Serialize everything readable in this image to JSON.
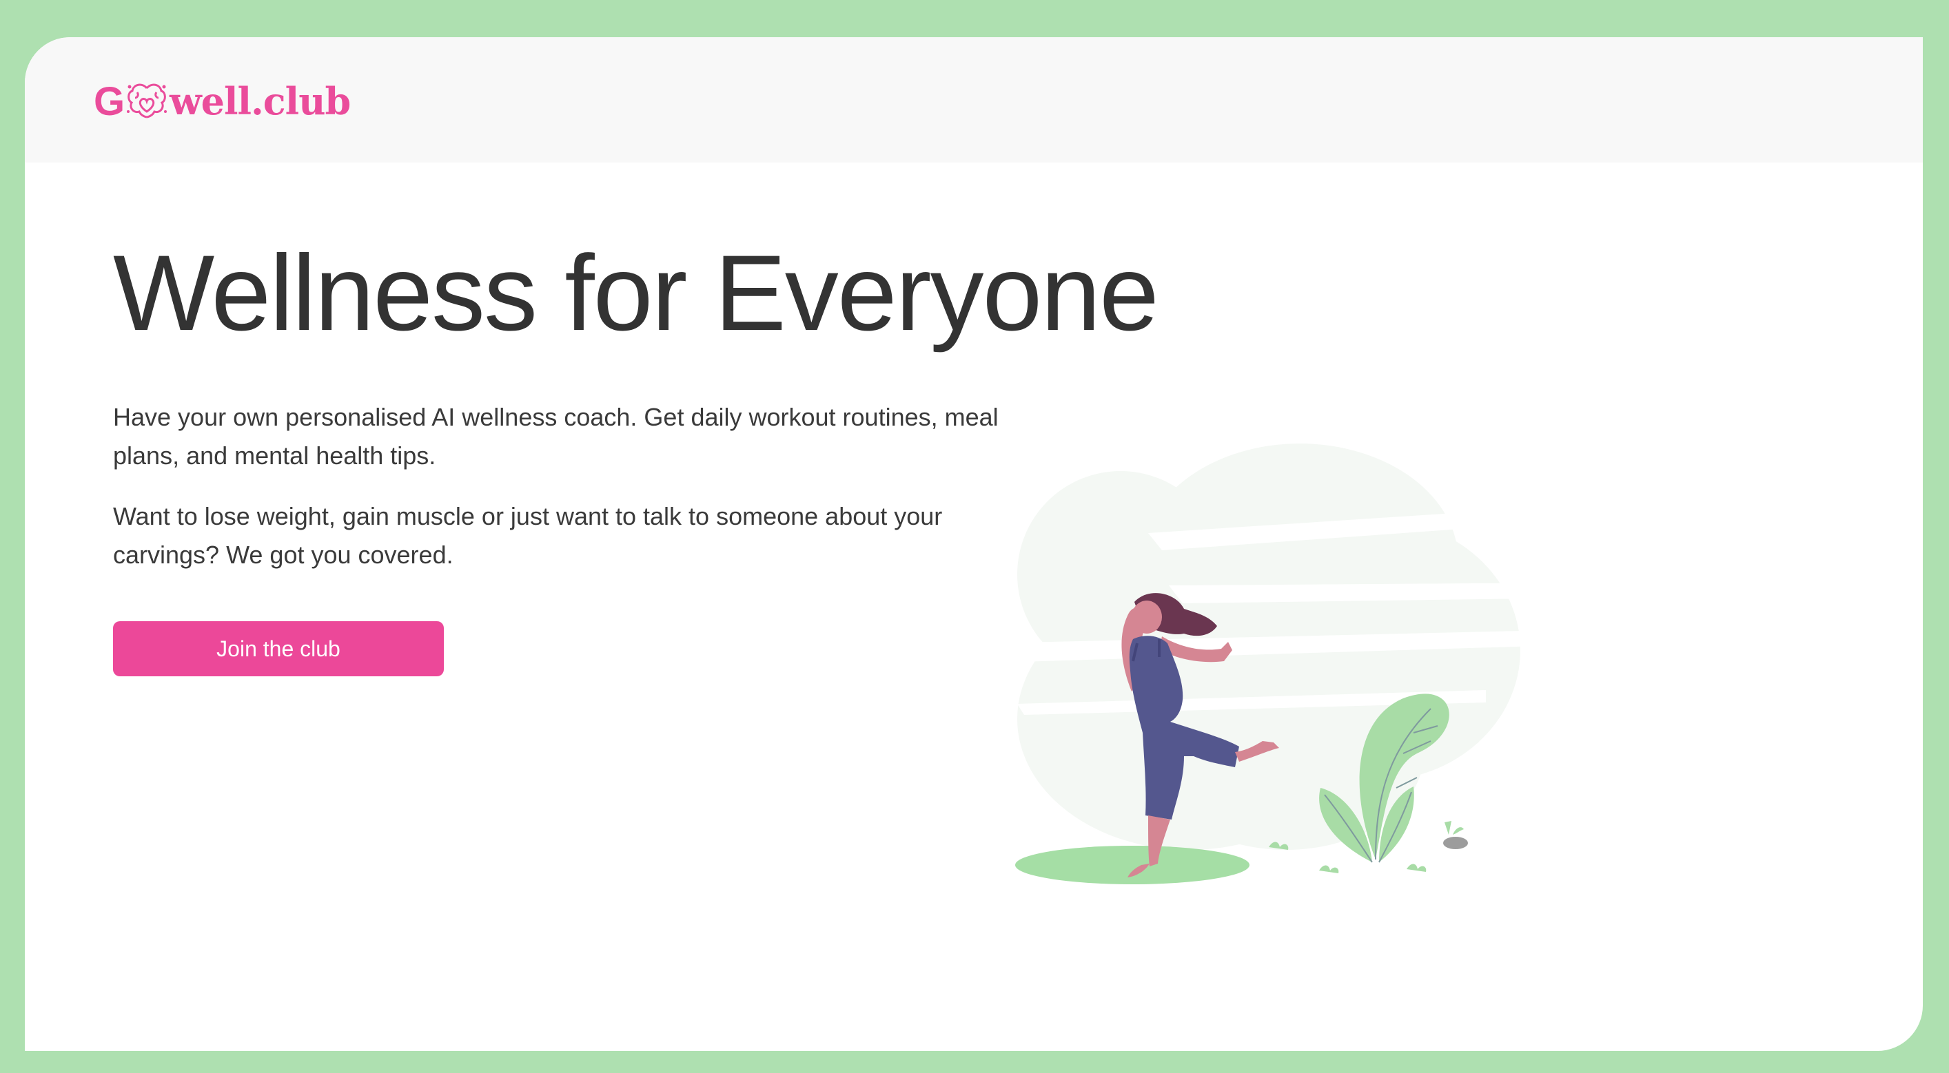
{
  "brand": {
    "name_prefix": "G",
    "name_suffix": "well.club",
    "color": "#ea4c9b"
  },
  "hero": {
    "title": "Wellness for Everyone",
    "paragraph_1": "Have your own personalised AI wellness coach. Get daily workout routines, meal plans, and mental health tips.",
    "paragraph_2": "Want to lose weight, gain muscle or just want to talk to someone about your carvings? We got you covered.",
    "cta_label": "Join the club"
  },
  "colors": {
    "background_frame": "#aee0b0",
    "accent": "#ec4899",
    "text": "#333333",
    "topbar": "#f8f8f8"
  },
  "icons": {
    "logo_mark": "brain-heart-icon",
    "illustration": "dancing-woman-illustration"
  }
}
